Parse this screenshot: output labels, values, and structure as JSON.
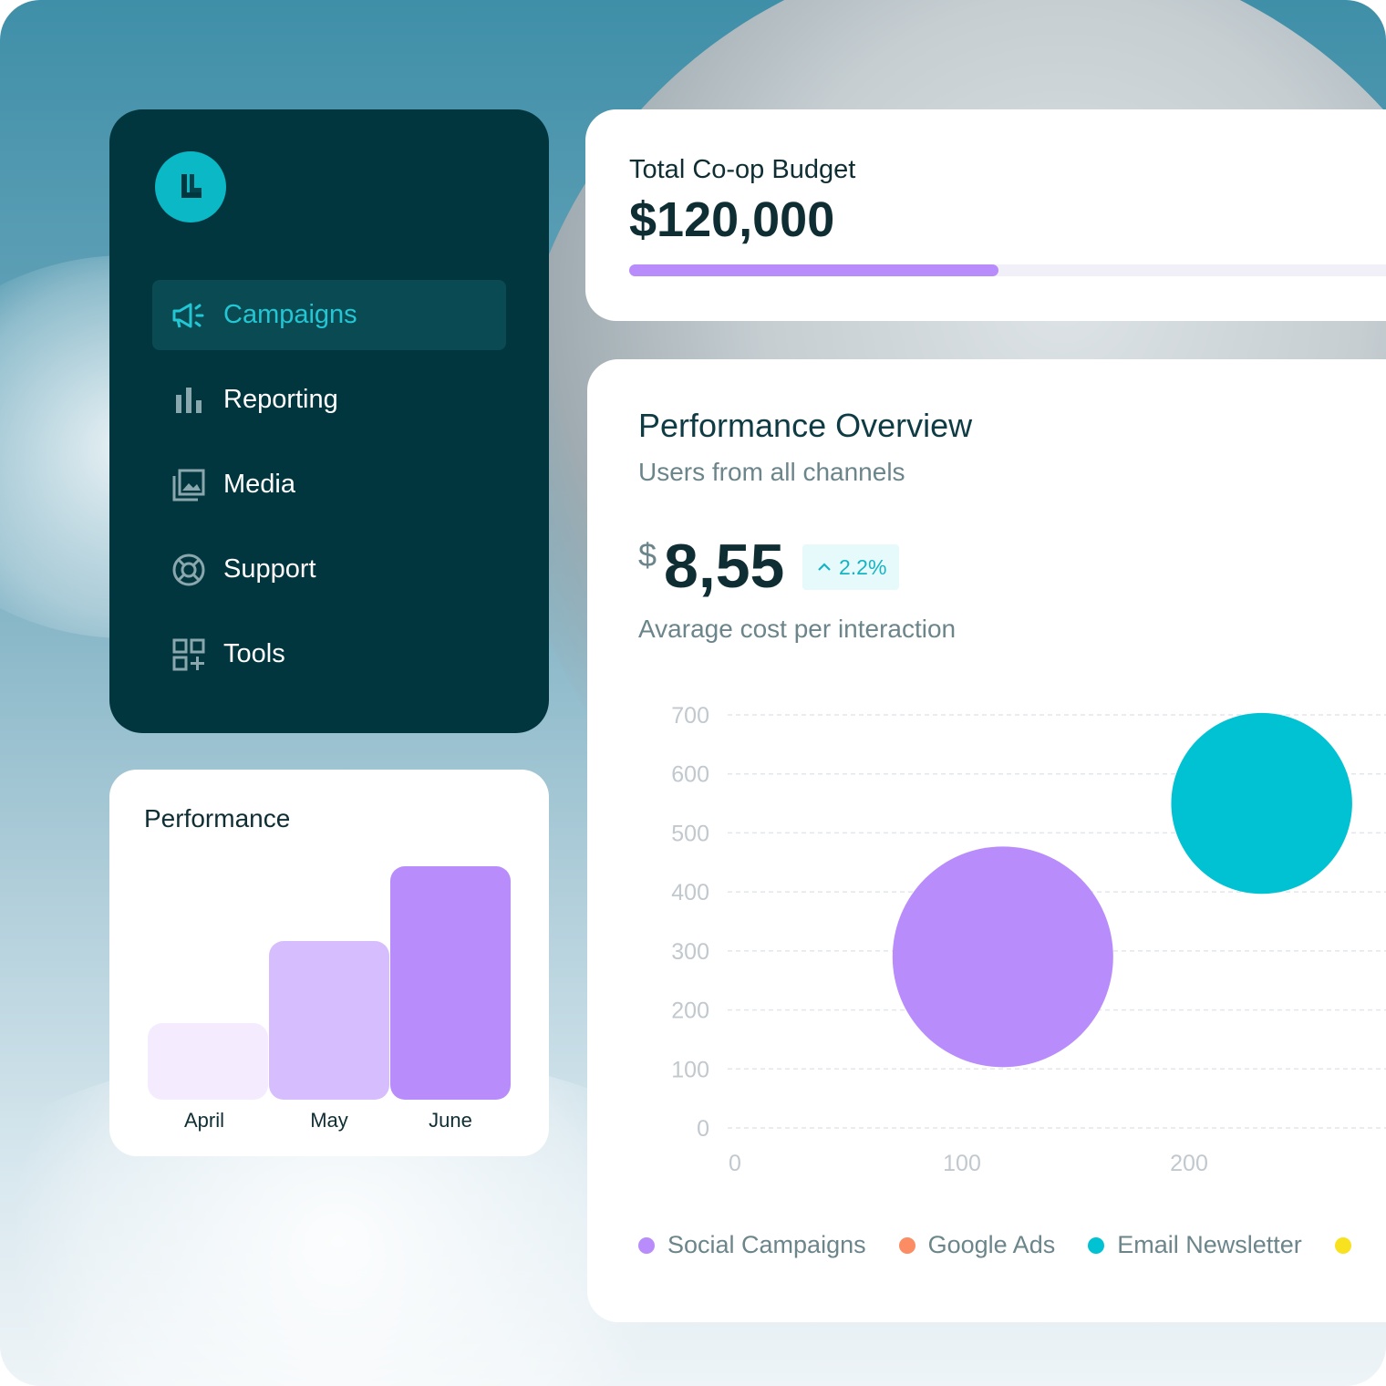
{
  "sidebar": {
    "items": [
      {
        "label": "Campaigns",
        "icon": "megaphone-icon",
        "active": true
      },
      {
        "label": "Reporting",
        "icon": "bar-chart-icon"
      },
      {
        "label": "Media",
        "icon": "image-gallery-icon"
      },
      {
        "label": "Support",
        "icon": "lifebuoy-icon"
      },
      {
        "label": "Tools",
        "icon": "grid-add-icon"
      }
    ]
  },
  "performance": {
    "title": "Performance",
    "chart_data": {
      "type": "bar",
      "categories": [
        "April",
        "May",
        "June"
      ],
      "values": [
        0.33,
        0.68,
        1.0
      ],
      "colors": [
        "#f4ecfe",
        "#d6bdfd",
        "#b98cfb"
      ]
    }
  },
  "budget": {
    "title": "Total Co-op Budget",
    "value": "$120,000",
    "progress_fraction": 0.45,
    "progress_color": "#b98cfb"
  },
  "overview": {
    "title": "Performance Overview",
    "subtitle": "Users from all channels",
    "currency": "$",
    "value": "8,55",
    "change": "2.2%",
    "change_direction": "up",
    "caption": "Avarage cost per interaction",
    "chart_data": {
      "type": "scatter",
      "ylim": [
        0,
        700
      ],
      "y_ticks": [
        700,
        600,
        500,
        400,
        300,
        200,
        100,
        0
      ],
      "x_ticks": [
        0,
        100,
        200
      ],
      "grid": true,
      "series": [
        {
          "name": "Social Campaigns",
          "color": "#b98cfb",
          "points": [
            {
              "x": 118,
              "y": 290,
              "r": 100
            }
          ]
        },
        {
          "name": "Google Ads",
          "color": "#fb8c63",
          "points": []
        },
        {
          "name": "Email Newsletter",
          "color": "#01c2d3",
          "points": [
            {
              "x": 232,
              "y": 550,
              "r": 82
            }
          ]
        },
        {
          "name": "",
          "color": "#f8e11f",
          "points": []
        }
      ]
    }
  }
}
